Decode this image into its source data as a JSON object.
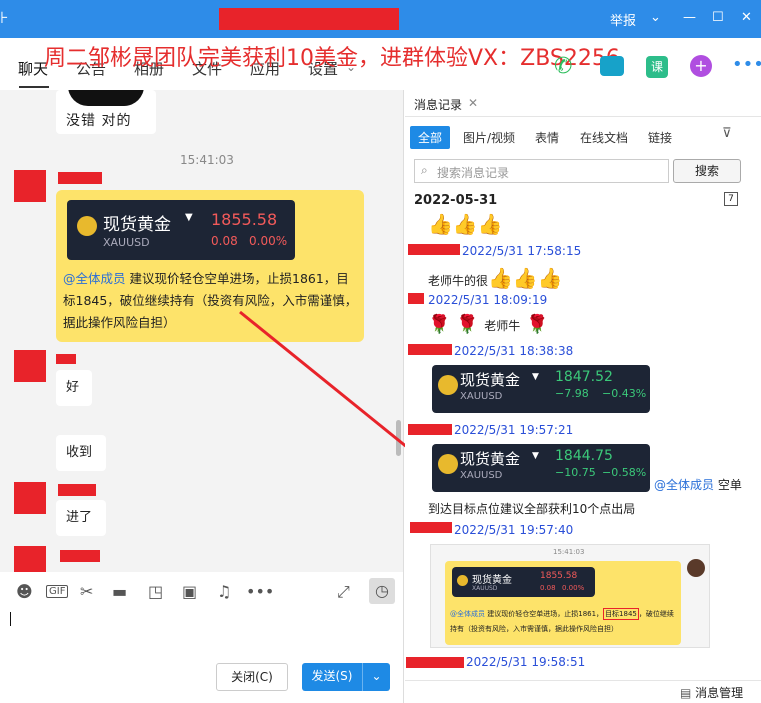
{
  "overlay": {
    "title": "周二邹彬晟团队完美获利10美金，进群体验VX：ZBS2256"
  },
  "titlebar": {
    "report": "举报"
  },
  "header": {
    "tabs": [
      "聊天",
      "公告",
      "相册",
      "文件",
      "应用",
      "设置"
    ]
  },
  "chat": {
    "sticker_caption": "没错 对的",
    "time": "15:41:03",
    "card1": {
      "name": "现货黄金",
      "symbol": "XAUUSD",
      "price": "1855.58",
      "change": "0.08",
      "pct": "0.00%"
    },
    "msg1_mention": "@全体成员",
    "msg1_text": " 建议现价轻仓空单进场，止损1861，目标1845，破位继续持有（投资有风险，入市需谨慎，据此操作风险自担）",
    "msg_hao": "好",
    "msg_shoudao": "收到",
    "msg_jinle": "进了"
  },
  "input": {
    "close": "关闭(C)",
    "send": "发送(S)"
  },
  "right": {
    "header": "消息记录",
    "filters": [
      "全部",
      "图片/视频",
      "表情",
      "在线文档",
      "链接"
    ],
    "search_placeholder": "搜索消息记录",
    "search_button": "搜索",
    "date": "2022-05-31",
    "ts1": "2022/5/31 17:58:15",
    "msg_niu": "老师牛的很",
    "ts2": "2022/5/31 18:09:19",
    "msg_niu2": "老师牛",
    "ts3": "2022/5/31 18:38:38",
    "card2": {
      "name": "现货黄金",
      "symbol": "XAUUSD",
      "price": "1847.52",
      "change": "−7.98",
      "pct": "−0.43%"
    },
    "ts4": "2022/5/31 19:57:21",
    "card3": {
      "name": "现货黄金",
      "symbol": "XAUUSD",
      "price": "1844.75",
      "change": "−10.75",
      "pct": "−0.58%"
    },
    "card3_mention": "@全体成员",
    "card3_text": "空单",
    "msg_arrive": "到达目标点位建议全部获利10个点出局",
    "ts5": "2022/5/31 19:57:40",
    "mini_time": "15:41:03",
    "mini_card": {
      "name": "现货黄金",
      "symbol": "XAUUSD",
      "price": "1855.58",
      "change": "0.08",
      "pct": "0.00%"
    },
    "mini_mention": "@全体成员",
    "mini_text": "建议现价轻仓空单进场，止损1861，",
    "mini_target": "目标1845",
    "mini_text2": "，破位继续持有（投资有风险，入市需谨慎，据此操作风险自担）",
    "ts6": "2022/5/31 19:58:51",
    "manage": "消息管理"
  }
}
